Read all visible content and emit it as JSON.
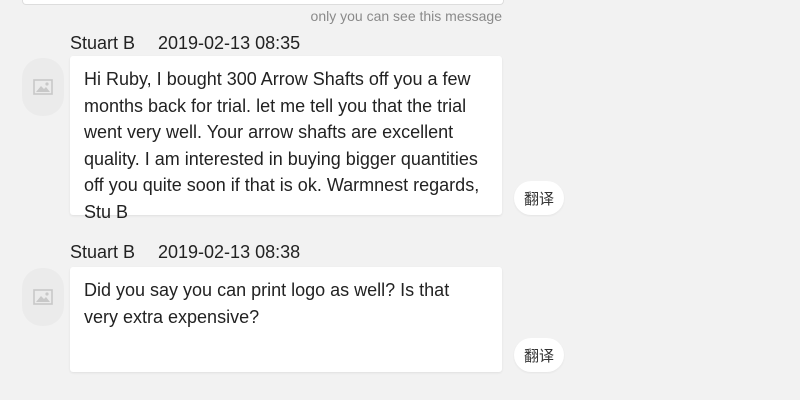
{
  "private_note": "only you can see this message",
  "messages": [
    {
      "sender": "Stuart B",
      "timestamp": "2019-02-13 08:35",
      "text": "Hi Ruby, I bought 300 Arrow Shafts off you a few months back for trial. let me tell you that the trial went very well. Your arrow shafts are excellent quality. I am interested in buying bigger quantities off you  quite soon if that is ok. Warmnest regards, Stu B",
      "translate_label": "翻译"
    },
    {
      "sender": "Stuart B",
      "timestamp": "2019-02-13 08:38",
      "text": "Did you say you can print logo as well? Is that very extra expensive?",
      "translate_label": "翻译"
    }
  ],
  "icons": {
    "avatar": "image-placeholder-icon"
  },
  "colors": {
    "background": "#f2f2f2",
    "bubble": "#ffffff",
    "note_text": "#8a8a8a"
  }
}
